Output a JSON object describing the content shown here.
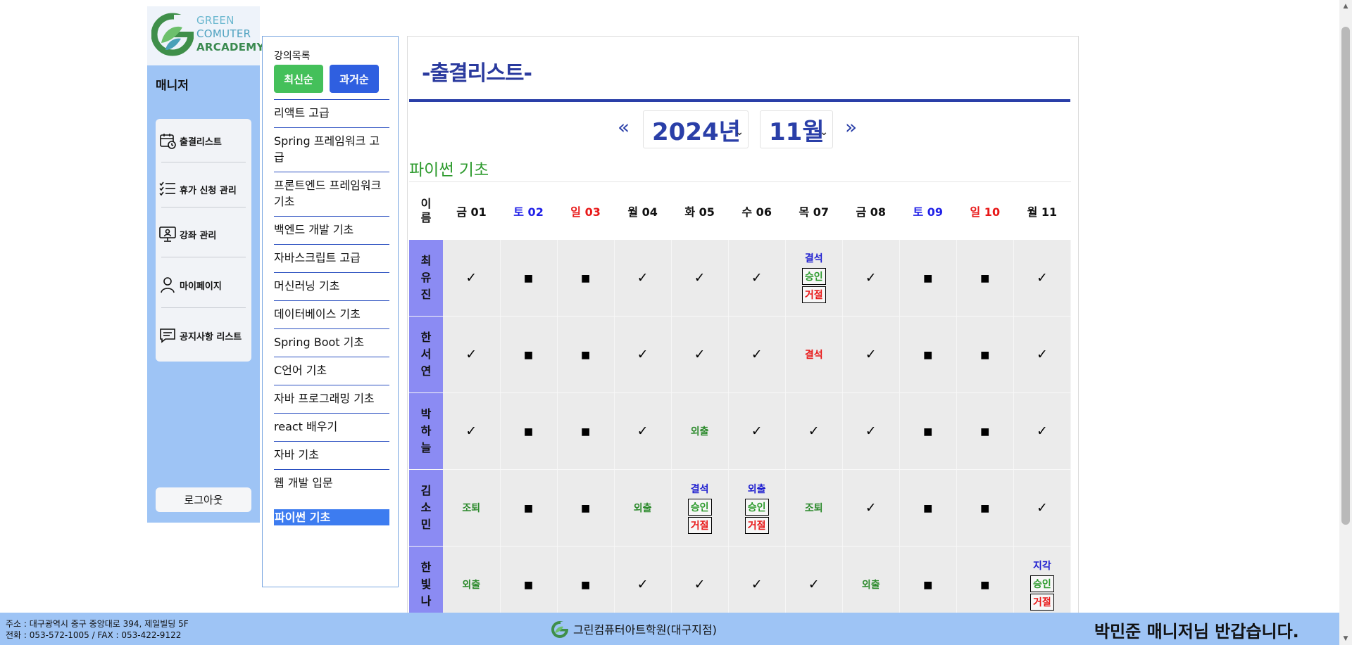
{
  "brand": {
    "logo_lines": [
      "GREEN",
      "COMUTER",
      "ARCADEMY"
    ]
  },
  "sidebar": {
    "title": "매니저",
    "items": [
      {
        "label": "출결리스트",
        "icon": "calendar-clock-icon"
      },
      {
        "label": "휴가 신청 관리",
        "icon": "checklist-icon"
      },
      {
        "label": "강좌 관리",
        "icon": "monitor-user-icon"
      },
      {
        "label": "마이페이지",
        "icon": "user-icon"
      },
      {
        "label": "공지사항 리스트",
        "icon": "chat-notice-icon"
      }
    ],
    "logout_label": "로그아웃"
  },
  "course_panel": {
    "title": "강의목록",
    "sort_new_label": "최신순",
    "sort_old_label": "과거순",
    "courses": [
      "리액트 고급",
      "Spring 프레임워크 고급",
      "프론트엔드 프레임워크 기초",
      "백엔드 개발 기초",
      "자바스크립트 고급",
      "머신러닝 기초",
      "데이터베이스 기초",
      "Spring Boot 기초",
      "C언어 기초",
      "자바 프로그래밍 기초",
      "react 배우기",
      "자바 기초",
      "웹 개발 입문"
    ],
    "active_course": "파이썬 기초"
  },
  "main": {
    "heading": "-출결리스트-",
    "prev_label": "«",
    "next_label": "»",
    "year_value": "2024년",
    "month_value": "11월",
    "course_name": "파이썬 기초",
    "name_header": "이름",
    "days": [
      {
        "label": "금 01",
        "kind": "weekday"
      },
      {
        "label": "토 02",
        "kind": "sat"
      },
      {
        "label": "일 03",
        "kind": "sun"
      },
      {
        "label": "월 04",
        "kind": "weekday"
      },
      {
        "label": "화 05",
        "kind": "weekday"
      },
      {
        "label": "수 06",
        "kind": "weekday"
      },
      {
        "label": "목 07",
        "kind": "weekday"
      },
      {
        "label": "금 08",
        "kind": "weekday"
      },
      {
        "label": "토 09",
        "kind": "sat"
      },
      {
        "label": "일 10",
        "kind": "sun"
      },
      {
        "label": "월 11",
        "kind": "weekday"
      }
    ],
    "approve_label": "승인",
    "reject_label": "거절",
    "rows": [
      {
        "name": "최유진",
        "cells": [
          {
            "t": "check",
            "v": "✓"
          },
          {
            "t": "box",
            "v": "■"
          },
          {
            "t": "box",
            "v": "■"
          },
          {
            "t": "check",
            "v": "✓"
          },
          {
            "t": "check",
            "v": "✓"
          },
          {
            "t": "check",
            "v": "✓"
          },
          {
            "t": "request",
            "v": "결석"
          },
          {
            "t": "check",
            "v": "✓"
          },
          {
            "t": "box",
            "v": "■"
          },
          {
            "t": "box",
            "v": "■"
          },
          {
            "t": "check",
            "v": "✓"
          }
        ]
      },
      {
        "name": "한서연",
        "cells": [
          {
            "t": "check",
            "v": "✓"
          },
          {
            "t": "box",
            "v": "■"
          },
          {
            "t": "box",
            "v": "■"
          },
          {
            "t": "check",
            "v": "✓"
          },
          {
            "t": "check",
            "v": "✓"
          },
          {
            "t": "check",
            "v": "✓"
          },
          {
            "t": "red",
            "v": "결석"
          },
          {
            "t": "check",
            "v": "✓"
          },
          {
            "t": "box",
            "v": "■"
          },
          {
            "t": "box",
            "v": "■"
          },
          {
            "t": "check",
            "v": "✓"
          }
        ]
      },
      {
        "name": "박하늘",
        "cells": [
          {
            "t": "check",
            "v": "✓"
          },
          {
            "t": "box",
            "v": "■"
          },
          {
            "t": "box",
            "v": "■"
          },
          {
            "t": "check",
            "v": "✓"
          },
          {
            "t": "green",
            "v": "외출"
          },
          {
            "t": "check",
            "v": "✓"
          },
          {
            "t": "check",
            "v": "✓"
          },
          {
            "t": "check",
            "v": "✓"
          },
          {
            "t": "box",
            "v": "■"
          },
          {
            "t": "box",
            "v": "■"
          },
          {
            "t": "check",
            "v": "✓"
          }
        ]
      },
      {
        "name": "김소민",
        "cells": [
          {
            "t": "green",
            "v": "조퇴"
          },
          {
            "t": "box",
            "v": "■"
          },
          {
            "t": "box",
            "v": "■"
          },
          {
            "t": "green",
            "v": "외출"
          },
          {
            "t": "request",
            "v": "결석"
          },
          {
            "t": "request",
            "v": "외출"
          },
          {
            "t": "green",
            "v": "조퇴"
          },
          {
            "t": "check",
            "v": "✓"
          },
          {
            "t": "box",
            "v": "■"
          },
          {
            "t": "box",
            "v": "■"
          },
          {
            "t": "check",
            "v": "✓"
          }
        ]
      },
      {
        "name": "한빛나",
        "cells": [
          {
            "t": "green",
            "v": "외출"
          },
          {
            "t": "box",
            "v": "■"
          },
          {
            "t": "box",
            "v": "■"
          },
          {
            "t": "check",
            "v": "✓"
          },
          {
            "t": "check",
            "v": "✓"
          },
          {
            "t": "check",
            "v": "✓"
          },
          {
            "t": "check",
            "v": "✓"
          },
          {
            "t": "green",
            "v": "외출"
          },
          {
            "t": "box",
            "v": "■"
          },
          {
            "t": "box",
            "v": "■"
          },
          {
            "t": "request",
            "v": "지각"
          }
        ]
      }
    ]
  },
  "footer": {
    "address": "주소 : 대구광역시 중구 중앙대로 394, 제일빌딩 5F",
    "phone": "전화 : 053-572-1005 / FAX : 053-422-9122",
    "academy_name": "그린컴퓨터아트학원(대구지점)",
    "greeting": "박민준 매니저님 반갑습니다."
  },
  "colors": {
    "sidebar_bg": "#9ec4f5",
    "heading_blue": "#2a3fa8",
    "course_green": "#2c9a2c",
    "name_cell": "#8b8bf3",
    "saturday": "#2020e8",
    "sunday": "#e81818"
  }
}
